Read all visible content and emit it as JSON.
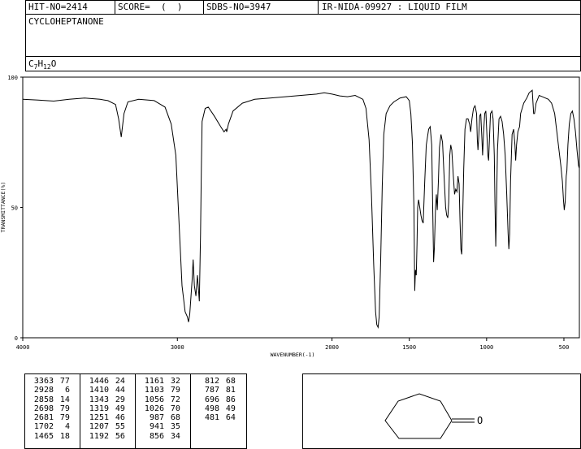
{
  "header": {
    "hit_no": "HIT-NO=2414",
    "score": "SCORE=  (  )",
    "sdbs_no": "SDBS-NO=3947",
    "ir_nida": "IR-NIDA-09927 : LIQUID FILM",
    "compound": "CYCLOHEPTANONE",
    "formula": {
      "c": "C",
      "c_sub": "7",
      "h": "H",
      "h_sub": "12",
      "o": "O"
    }
  },
  "chart_data": {
    "type": "line",
    "xlabel": "WAVENUMBER(-1)",
    "ylabel": "TRANSMITTANCE(%)",
    "xlim": [
      4000,
      400
    ],
    "ylim": [
      0,
      100
    ],
    "x_ticks": [
      "4000",
      "3000",
      "2000",
      "1500",
      "1000",
      "500"
    ],
    "y_ticks": [
      "0",
      "50",
      "100"
    ],
    "series": [
      {
        "points": [
          [
            4000,
            91.5
          ],
          [
            3900,
            91.2
          ],
          [
            3800,
            90.8
          ],
          [
            3700,
            91.5
          ],
          [
            3600,
            92.0
          ],
          [
            3500,
            91.5
          ],
          [
            3450,
            91.0
          ],
          [
            3400,
            89.5
          ],
          [
            3380,
            84
          ],
          [
            3363,
            77
          ],
          [
            3345,
            86
          ],
          [
            3320,
            90.5
          ],
          [
            3250,
            91.5
          ],
          [
            3150,
            91.0
          ],
          [
            3080,
            88.5
          ],
          [
            3040,
            82
          ],
          [
            3010,
            70
          ],
          [
            2990,
            45
          ],
          [
            2970,
            20
          ],
          [
            2950,
            10
          ],
          [
            2935,
            8
          ],
          [
            2928,
            6
          ],
          [
            2920,
            9
          ],
          [
            2905,
            22
          ],
          [
            2898,
            30
          ],
          [
            2890,
            20
          ],
          [
            2880,
            16
          ],
          [
            2870,
            24
          ],
          [
            2858,
            14
          ],
          [
            2850,
            40
          ],
          [
            2845,
            65
          ],
          [
            2840,
            83
          ],
          [
            2820,
            88
          ],
          [
            2800,
            88.5
          ],
          [
            2760,
            85
          ],
          [
            2720,
            81
          ],
          [
            2698,
            79
          ],
          [
            2685,
            80
          ],
          [
            2681,
            79
          ],
          [
            2670,
            82
          ],
          [
            2640,
            87
          ],
          [
            2580,
            90
          ],
          [
            2500,
            91.5
          ],
          [
            2400,
            92.0
          ],
          [
            2300,
            92.5
          ],
          [
            2200,
            93.0
          ],
          [
            2100,
            93.5
          ],
          [
            2050,
            94.0
          ],
          [
            2000,
            93.5
          ],
          [
            1950,
            92.8
          ],
          [
            1900,
            92.5
          ],
          [
            1850,
            93
          ],
          [
            1800,
            91.5
          ],
          [
            1780,
            88
          ],
          [
            1760,
            76
          ],
          [
            1745,
            55
          ],
          [
            1730,
            28
          ],
          [
            1718,
            10
          ],
          [
            1710,
            5
          ],
          [
            1702,
            4
          ],
          [
            1695,
            8
          ],
          [
            1685,
            30
          ],
          [
            1675,
            58
          ],
          [
            1665,
            78
          ],
          [
            1650,
            86
          ],
          [
            1625,
            89
          ],
          [
            1600,
            90.5
          ],
          [
            1560,
            92
          ],
          [
            1520,
            92.5
          ],
          [
            1500,
            91
          ],
          [
            1490,
            86
          ],
          [
            1480,
            75
          ],
          [
            1470,
            50
          ],
          [
            1465,
            18
          ],
          [
            1460,
            26
          ],
          [
            1455,
            24
          ],
          [
            1450,
            36
          ],
          [
            1446,
            50
          ],
          [
            1440,
            53
          ],
          [
            1435,
            51
          ],
          [
            1425,
            47
          ],
          [
            1418,
            45
          ],
          [
            1410,
            44
          ],
          [
            1400,
            60
          ],
          [
            1390,
            74
          ],
          [
            1375,
            80
          ],
          [
            1365,
            81
          ],
          [
            1355,
            74
          ],
          [
            1348,
            48
          ],
          [
            1343,
            29
          ],
          [
            1338,
            34
          ],
          [
            1330,
            50
          ],
          [
            1325,
            55
          ],
          [
            1319,
            49
          ],
          [
            1312,
            60
          ],
          [
            1305,
            73
          ],
          [
            1295,
            78
          ],
          [
            1285,
            75
          ],
          [
            1275,
            62
          ],
          [
            1265,
            50
          ],
          [
            1258,
            47
          ],
          [
            1251,
            46
          ],
          [
            1245,
            52
          ],
          [
            1238,
            70
          ],
          [
            1232,
            74
          ],
          [
            1225,
            72
          ],
          [
            1215,
            62
          ],
          [
            1207,
            55
          ],
          [
            1200,
            57
          ],
          [
            1192,
            56
          ],
          [
            1185,
            62
          ],
          [
            1178,
            59
          ],
          [
            1172,
            45
          ],
          [
            1166,
            34
          ],
          [
            1161,
            32
          ],
          [
            1155,
            45
          ],
          [
            1148,
            65
          ],
          [
            1140,
            80
          ],
          [
            1130,
            84
          ],
          [
            1120,
            84
          ],
          [
            1110,
            82
          ],
          [
            1103,
            79
          ],
          [
            1095,
            84
          ],
          [
            1085,
            88
          ],
          [
            1075,
            89
          ],
          [
            1065,
            86
          ],
          [
            1060,
            76
          ],
          [
            1056,
            72
          ],
          [
            1050,
            78
          ],
          [
            1045,
            85
          ],
          [
            1038,
            86
          ],
          [
            1030,
            76
          ],
          [
            1026,
            70
          ],
          [
            1020,
            78
          ],
          [
            1012,
            86
          ],
          [
            1005,
            87
          ],
          [
            998,
            78
          ],
          [
            992,
            70
          ],
          [
            987,
            68
          ],
          [
            982,
            76
          ],
          [
            975,
            86
          ],
          [
            965,
            87
          ],
          [
            958,
            84
          ],
          [
            950,
            70
          ],
          [
            946,
            52
          ],
          [
            941,
            35
          ],
          [
            936,
            50
          ],
          [
            930,
            72
          ],
          [
            920,
            84
          ],
          [
            910,
            85
          ],
          [
            900,
            83
          ],
          [
            890,
            78
          ],
          [
            880,
            70
          ],
          [
            870,
            55
          ],
          [
            861,
            40
          ],
          [
            856,
            34
          ],
          [
            851,
            40
          ],
          [
            845,
            60
          ],
          [
            835,
            78
          ],
          [
            825,
            80
          ],
          [
            817,
            74
          ],
          [
            812,
            68
          ],
          [
            806,
            74
          ],
          [
            798,
            79
          ],
          [
            787,
            81
          ],
          [
            780,
            86
          ],
          [
            770,
            88
          ],
          [
            760,
            90
          ],
          [
            740,
            92
          ],
          [
            725,
            94
          ],
          [
            705,
            95
          ],
          [
            696,
            86
          ],
          [
            690,
            86
          ],
          [
            680,
            90
          ],
          [
            660,
            93
          ],
          [
            640,
            92.5
          ],
          [
            620,
            92
          ],
          [
            600,
            91.5
          ],
          [
            580,
            90
          ],
          [
            560,
            86
          ],
          [
            540,
            76
          ],
          [
            520,
            66
          ],
          [
            510,
            60
          ],
          [
            503,
            53
          ],
          [
            498,
            49
          ],
          [
            492,
            52
          ],
          [
            485,
            62
          ],
          [
            481,
            64
          ],
          [
            474,
            74
          ],
          [
            465,
            82
          ],
          [
            455,
            86
          ],
          [
            445,
            87
          ],
          [
            435,
            84
          ],
          [
            425,
            79
          ],
          [
            415,
            72
          ],
          [
            405,
            66
          ],
          [
            400,
            65
          ]
        ]
      }
    ],
    "peak_table": [
      [
        [
          "3363",
          "77"
        ],
        [
          "1446",
          "24"
        ],
        [
          "1161",
          "32"
        ],
        [
          "812",
          "68"
        ]
      ],
      [
        [
          "2928",
          "6"
        ],
        [
          "1410",
          "44"
        ],
        [
          "1103",
          "79"
        ],
        [
          "787",
          "81"
        ]
      ],
      [
        [
          "2858",
          "14"
        ],
        [
          "1343",
          "29"
        ],
        [
          "1056",
          "72"
        ],
        [
          "696",
          "86"
        ]
      ],
      [
        [
          "2698",
          "79"
        ],
        [
          "1319",
          "49"
        ],
        [
          "1026",
          "70"
        ],
        [
          "498",
          "49"
        ]
      ],
      [
        [
          "2681",
          "79"
        ],
        [
          "1251",
          "46"
        ],
        [
          "987",
          "68"
        ],
        [
          "481",
          "64"
        ]
      ],
      [
        [
          "1702",
          "4"
        ],
        [
          "1207",
          "55"
        ],
        [
          "941",
          "35"
        ],
        [
          "",
          ""
        ]
      ],
      [
        [
          "1465",
          "18"
        ],
        [
          "1192",
          "56"
        ],
        [
          "856",
          "34"
        ],
        [
          "",
          ""
        ]
      ]
    ]
  },
  "structure": {
    "oxygen_label": "O"
  }
}
